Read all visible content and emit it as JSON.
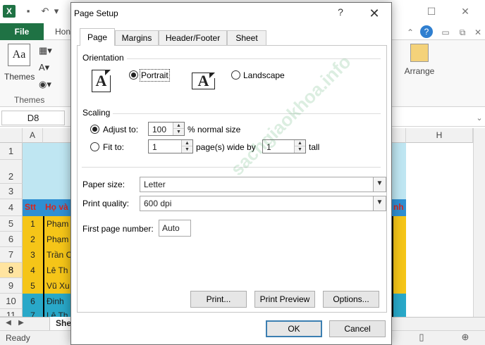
{
  "excel": {
    "file_tab": "File",
    "home_tab_partial": "Hon",
    "themes_label": "Themes",
    "themes_group_label": "Themes",
    "arrange_label": "Arrange",
    "name_box": "D8",
    "columns": [
      "A",
      "H"
    ],
    "rows": [
      "1",
      "2",
      "3",
      "4",
      "5",
      "6",
      "7",
      "8",
      "9",
      "10",
      "11"
    ],
    "header_row": {
      "stt": "Stt",
      "name_partial": "Họ và",
      "right_partial": "nh"
    },
    "data_rows": [
      {
        "stt": "1",
        "name": "Phạm"
      },
      {
        "stt": "2",
        "name": "Phạm"
      },
      {
        "stt": "3",
        "name": "Trần C"
      },
      {
        "stt": "4",
        "name": "Lê Th"
      },
      {
        "stt": "5",
        "name": "Vũ Xu"
      },
      {
        "stt": "6",
        "name": "Đinh"
      },
      {
        "stt": "7",
        "name": "Lê Th"
      }
    ],
    "sheet_tab": "She",
    "status": "Ready",
    "colors": {
      "excel_green": "#1f7244",
      "header_fill": "#2f8fd2",
      "orange_fill": "#f5c518",
      "teal_fill": "#29a8c8",
      "light_blue_fill": "#bfe6f2",
      "red_text": "#d9261c"
    }
  },
  "dialog": {
    "title": "Page Setup",
    "help": "?",
    "close": "✕",
    "tabs": [
      "Page",
      "Margins",
      "Header/Footer",
      "Sheet"
    ],
    "active_tab": "Page",
    "orientation": {
      "label": "Orientation",
      "portrait": "Portrait",
      "landscape": "Landscape",
      "selected": "Portrait",
      "glyph": "A"
    },
    "scaling": {
      "label": "Scaling",
      "adjust_to": "Adjust to:",
      "adjust_value": "100",
      "adjust_suffix": "% normal size",
      "fit_to": "Fit to:",
      "pages_wide": "1",
      "pages_wide_suffix": "page(s) wide by",
      "pages_tall": "1",
      "pages_tall_suffix": "tall",
      "selected": "Adjust to:"
    },
    "paper_size": {
      "label": "Paper size:",
      "value": "Letter"
    },
    "print_quality": {
      "label": "Print quality:",
      "value": "600 dpi"
    },
    "first_page": {
      "label": "First page number:",
      "value": "Auto"
    },
    "buttons": {
      "print": "Print...",
      "print_preview": "Print Preview",
      "options": "Options...",
      "ok": "OK",
      "cancel": "Cancel"
    }
  },
  "watermark": "sachgiaokhoa.info"
}
